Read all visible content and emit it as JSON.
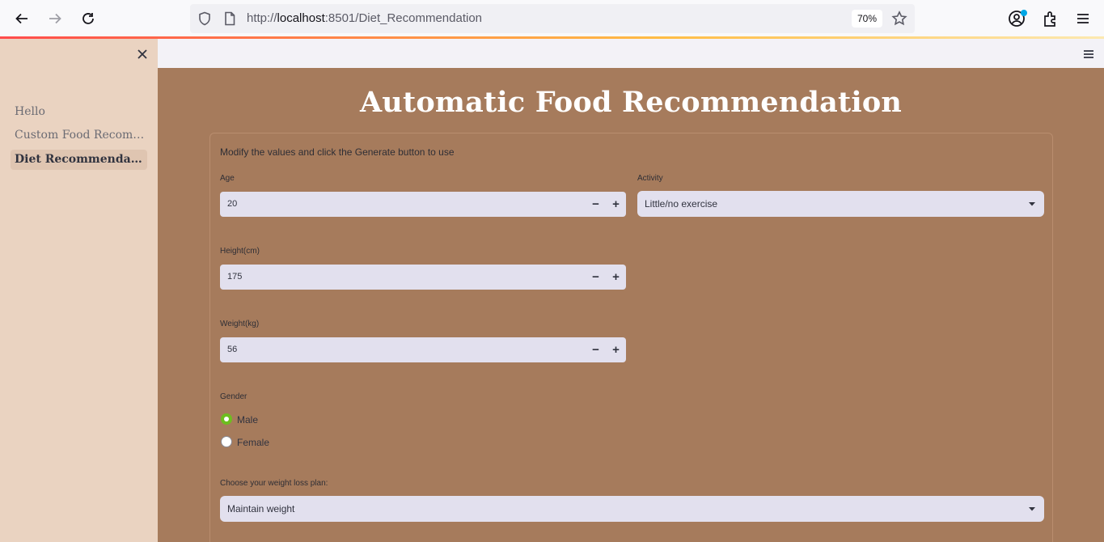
{
  "browser": {
    "url_prefix": "http://",
    "url_host": "localhost",
    "url_rest": ":8501/Diet_Recommendation",
    "zoom": "70%"
  },
  "sidebar": {
    "items": [
      {
        "label": "Hello"
      },
      {
        "label": "Custom Food Recommendation"
      },
      {
        "label": "Diet Recommendation"
      }
    ]
  },
  "main": {
    "title": "Automatic Food Recommendation",
    "intro": "Modify the values and click the Generate button to use",
    "age": {
      "label": "Age",
      "value": "20"
    },
    "activity": {
      "label": "Activity",
      "value": "Little/no exercise"
    },
    "height": {
      "label": "Height(cm)",
      "value": "175"
    },
    "weight": {
      "label": "Weight(kg)",
      "value": "56"
    },
    "gender": {
      "label": "Gender",
      "options": [
        "Male",
        "Female"
      ],
      "selected": "Male"
    },
    "plan": {
      "label": "Choose your weight loss plan:",
      "value": "Maintain weight"
    },
    "stepper": {
      "minus": "−",
      "plus": "+"
    }
  },
  "colors": {
    "sidebar_bg": "#ead3c1",
    "main_bg": "#a67b5c",
    "input_bg": "#e2e0ee",
    "radio_checked": "#6dbd1f"
  }
}
